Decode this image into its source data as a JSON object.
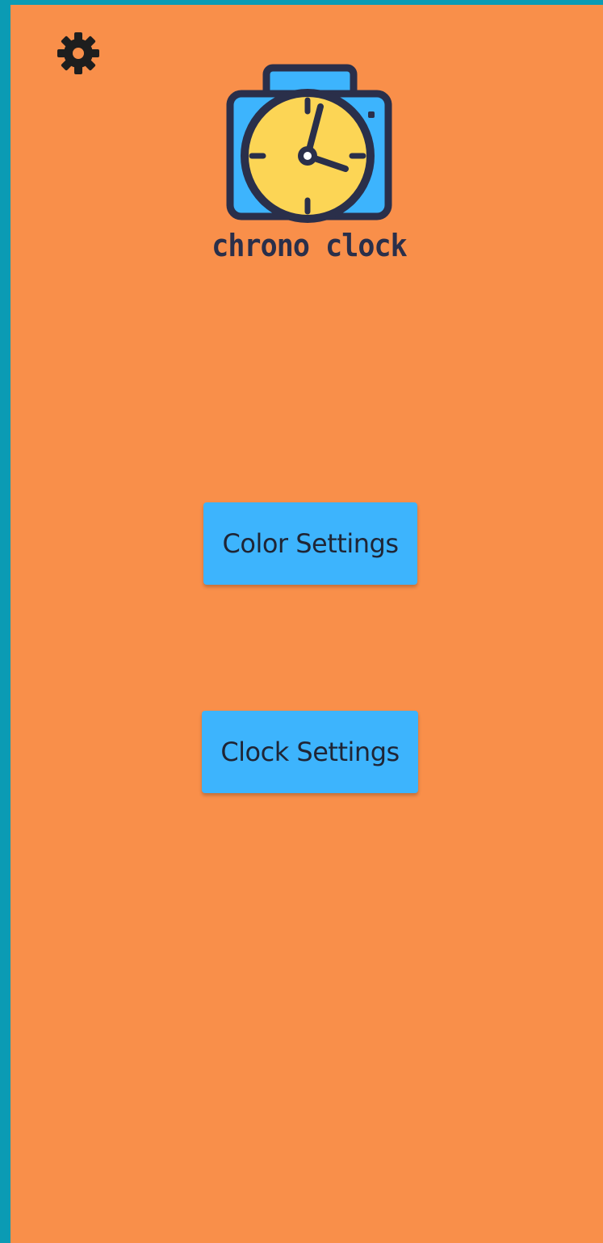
{
  "toolbar": {
    "settings_icon": "gear-icon"
  },
  "logo": {
    "icon": "camera-clock-icon",
    "text": "chrono clock"
  },
  "buttons": {
    "color_settings": "Color Settings",
    "clock_settings": "Clock Settings"
  },
  "colors": {
    "background": "#F98F4A",
    "border": "#0B9BB4",
    "button": "#3DB4FD",
    "clock_face": "#FCD555",
    "outline": "#2A2F4A"
  }
}
